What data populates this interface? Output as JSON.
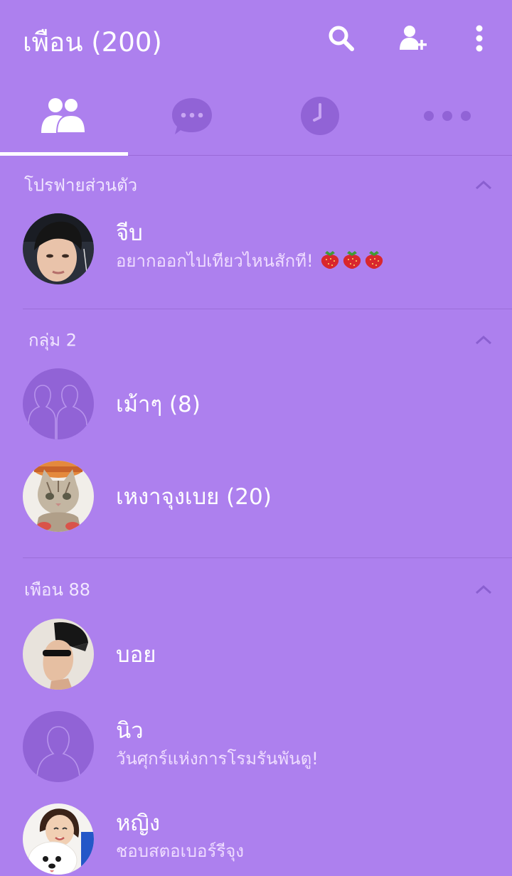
{
  "header": {
    "title": "เพือน (200)",
    "search_icon": "search-icon",
    "add_friend_icon": "add-friend-icon",
    "more_icon": "more-vertical-icon"
  },
  "tabs": [
    {
      "icon": "friends-icon",
      "active": true
    },
    {
      "icon": "chat-icon",
      "active": false
    },
    {
      "icon": "timeline-clock-icon",
      "active": false
    },
    {
      "icon": "more-horizontal-icon",
      "active": false
    }
  ],
  "sections": {
    "profile": {
      "label": "โปรฟายส่วนตัว",
      "user": {
        "name": "จีบ",
        "status": "อยากออกไปเทียวไหนสักที!",
        "emoji_icon": "strawberry-icon"
      }
    },
    "groups": {
      "label": "กลุ่ม 2",
      "items": [
        {
          "name": "เม้าๆ (8)",
          "avatar": "group-placeholder-icon"
        },
        {
          "name": "เหงาจุงเบย (20)",
          "avatar": "cat-photo"
        }
      ]
    },
    "friends": {
      "label": "เพือน 88",
      "items": [
        {
          "name": "บอย",
          "status": "",
          "avatar": "photo"
        },
        {
          "name": "นิว",
          "status": "วันศุกร์แห่งการโรมรันพันตู!",
          "avatar": "person-placeholder-icon"
        },
        {
          "name": "หญิง",
          "status": "ชอบสตอเบอร์รีจุง",
          "avatar": "photo"
        }
      ]
    }
  },
  "colors": {
    "background": "#ad80ee",
    "accent_dark": "#9163d6",
    "text": "#ffffff"
  }
}
